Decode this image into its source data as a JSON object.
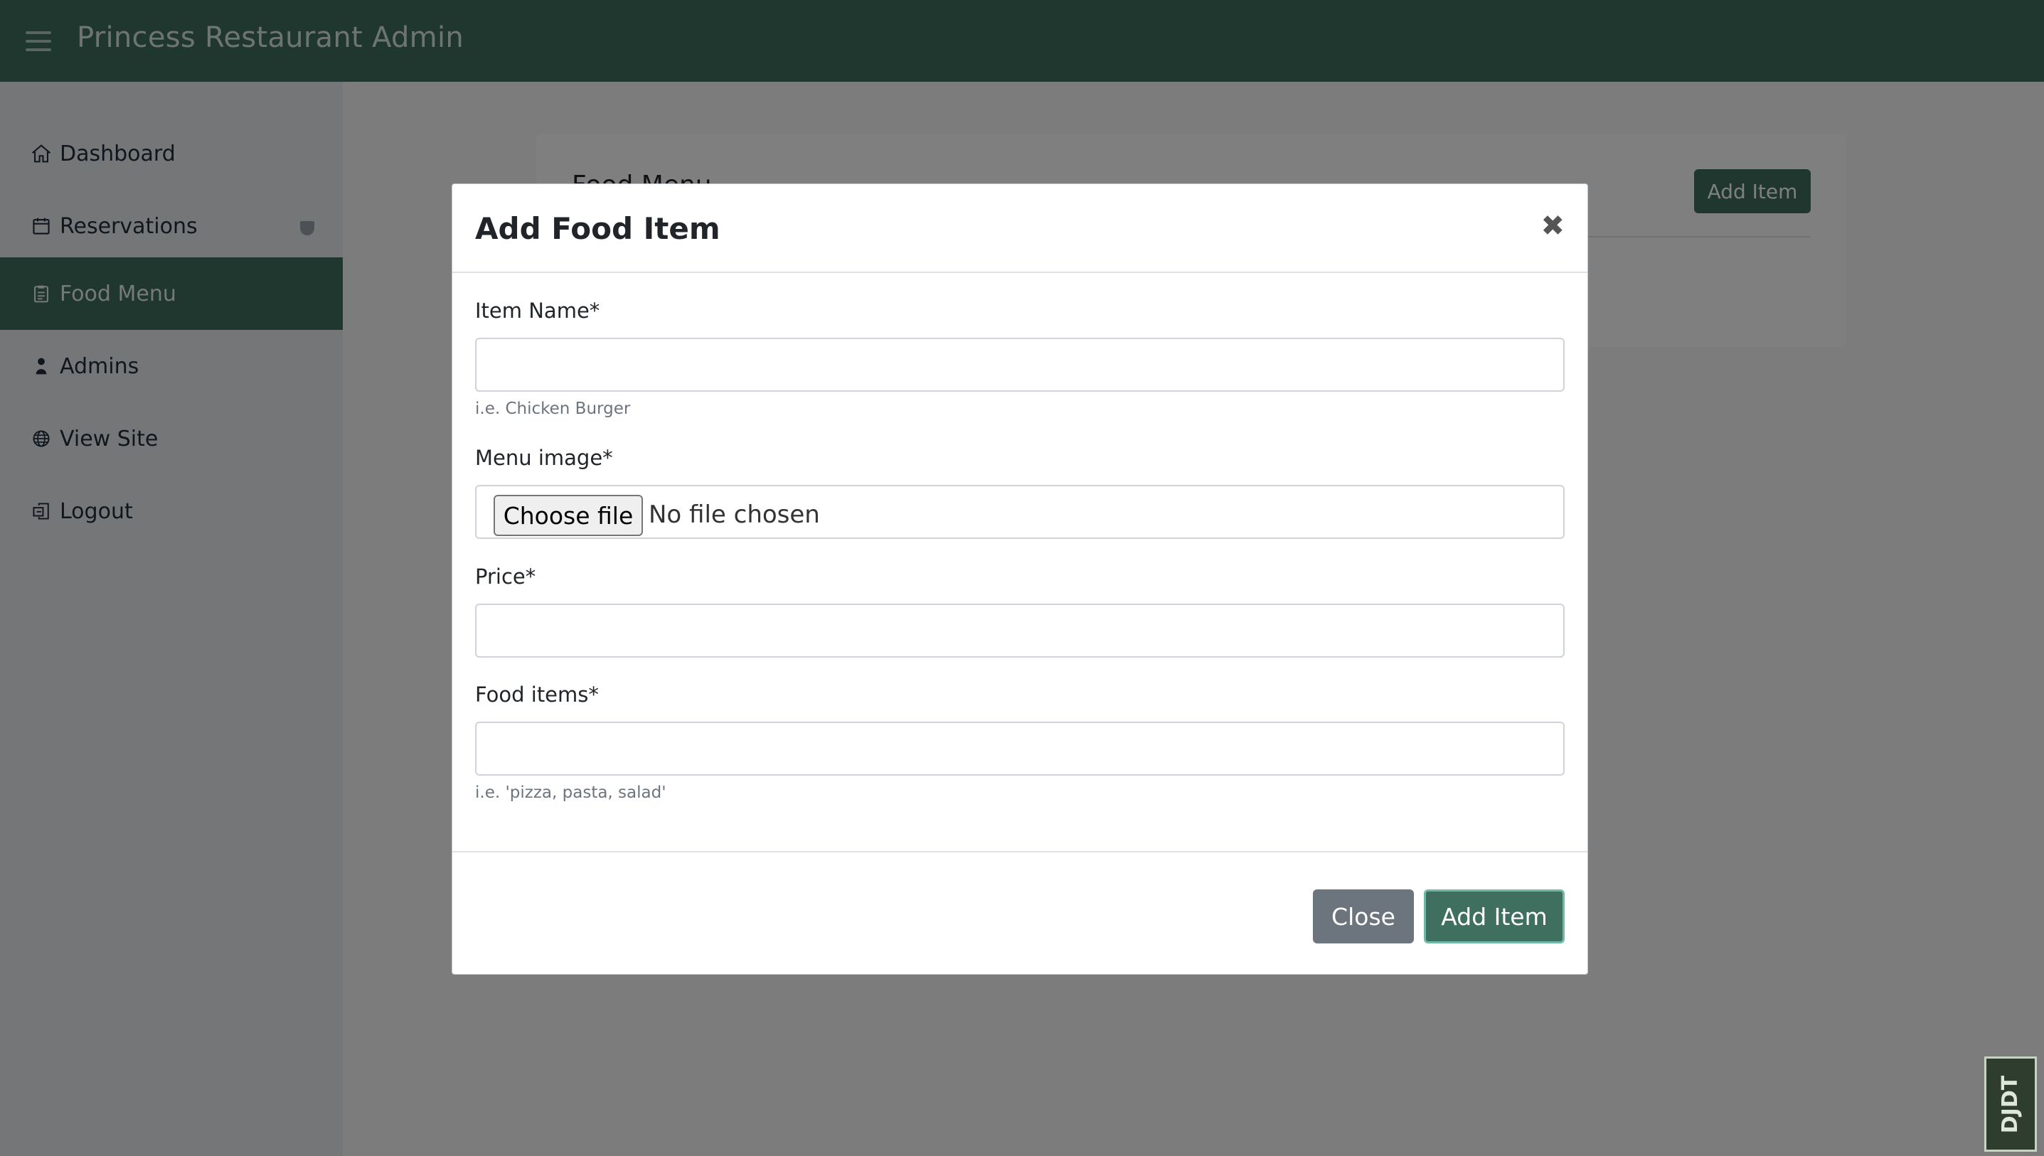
{
  "navbar": {
    "brand": "Princess Restaurant Admin",
    "menu_icon": "hamburger-icon"
  },
  "sidebar": {
    "items": [
      {
        "label": "Dashboard",
        "icon": "home-icon",
        "active": false
      },
      {
        "label": "Reservations",
        "icon": "calendar-icon",
        "active": false,
        "badge": "shield-badge-icon"
      },
      {
        "label": "Food Menu",
        "icon": "clipboard-icon",
        "active": true
      },
      {
        "label": "Admins",
        "icon": "user-icon",
        "active": false
      },
      {
        "label": "View Site",
        "icon": "globe-icon",
        "active": false
      },
      {
        "label": "Logout",
        "icon": "logout-icon",
        "active": false
      }
    ]
  },
  "main": {
    "card_title": "Food Menu",
    "add_button_label": "Add Item"
  },
  "modal": {
    "title": "Add Food Item",
    "close_icon": "close-icon",
    "fields": {
      "item_name": {
        "label": "Item Name*",
        "value": "",
        "help": "i.e. Chicken Burger"
      },
      "menu_image": {
        "label": "Menu image*",
        "button_label": "Choose file",
        "status": "No file chosen"
      },
      "price": {
        "label": "Price*",
        "value": ""
      },
      "food_items": {
        "label": "Food items*",
        "value": "",
        "help": "i.e. 'pizza, pasta, salad'"
      }
    },
    "footer": {
      "close_label": "Close",
      "add_label": "Add Item"
    }
  },
  "debug_toolbar": {
    "label": "DJDT"
  },
  "colors": {
    "primary": "#3f6f5e",
    "secondary": "#6c757d",
    "sidebar_bg": "#e9ecef"
  }
}
